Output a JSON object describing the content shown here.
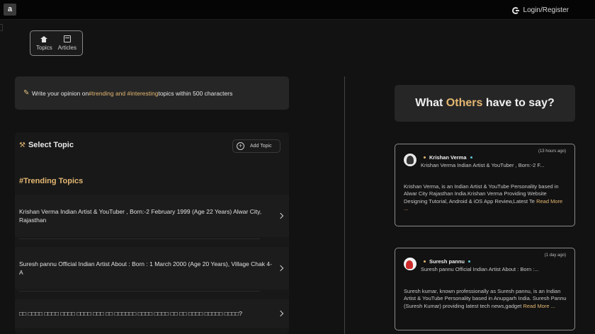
{
  "header": {
    "logo": "a",
    "login_label": "Login/Register",
    "google_icon": "google-icon"
  },
  "nav": {
    "items": [
      {
        "label": "Topics",
        "icon": "home-icon"
      },
      {
        "label": "Articles",
        "icon": "article-icon"
      }
    ]
  },
  "opinion": {
    "prefix": "Write your opinion on ",
    "tag1": "#trending and #interesting",
    "suffix": " topics within 500 characters"
  },
  "select_topic": {
    "title": "Select Topic",
    "add_label": "Add Topic",
    "trending_title": "#Trending Topics",
    "topics": [
      "Krishan Verma Indian Artist & YouTuber , Born:-2 February 1999 (Age 22 Years) Alwar City, Rajasthan",
      "Suresh pannu Official Indian Artist About : Born : 1 March 2000 (Age 20 Years), Village Chak 4-A",
      "□□ □□□□ □□□□ □□□□ □□□□ □□□ □□ □□□□□□ □□□□ □□□□ □□ □□ □□□□ □□□□□ □□□□?"
    ]
  },
  "others": {
    "word1": "What ",
    "highlight": "Others",
    "word2": " have to say?"
  },
  "cards": [
    {
      "time": "(13 hours ago)",
      "author": "Krishan Verma",
      "topic": "Krishan Verma Indian Artist & YouTuber , Born:-2 F...",
      "body": "Krishan Verma, is an Indian Artist & YouTube Personality based in Alwar City Rajasthan India.Krishan Verma Providing Website Designing Tutorial, Android & iOS App Review,Latest Te",
      "read_more": "Read More ..."
    },
    {
      "time": "(1 day ago)",
      "author": "Suresh pannu",
      "topic": "Suresh pannu Official Indian Artist About : Born :...",
      "body": "Suresh kumar, known professionally as Suresh pannu, is an Indian Artist & YouTube Personality based in Anupgarh India. Suresh Pannu (Suresh Kumar) providing latest tech news,gadget",
      "read_more": "Read More ..."
    }
  ]
}
